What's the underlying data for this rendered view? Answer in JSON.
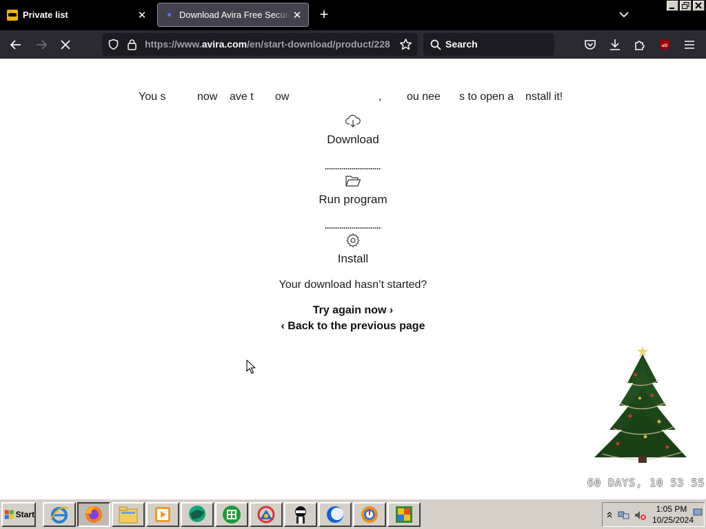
{
  "browser": {
    "tabs": [
      {
        "title": "Private list",
        "active": false
      },
      {
        "title": "Download Avira Free Security",
        "active": true
      }
    ],
    "url": {
      "prefix": "https://www.",
      "domain": "avira.com",
      "path": "/en/start-download/product/228"
    },
    "search_label": "Search",
    "accent_colors": {
      "tab_bg": "#42414d",
      "toolbar_bg": "#2b2a33",
      "field_bg": "#1c1b22"
    }
  },
  "page": {
    "instruction_fragments": [
      "You s",
      "now",
      "ave t",
      "ow",
      ",",
      "ou nee",
      "s to open a",
      "nstall it!"
    ],
    "steps": [
      {
        "label": "Download",
        "icon": "cloud-download-icon"
      },
      {
        "label": "Run program",
        "icon": "folder-open-icon"
      },
      {
        "label": "Install",
        "icon": "gear-icon"
      }
    ],
    "question": "Your download hasn’t started?",
    "try_again": "Try again now",
    "try_again_chevron": "›",
    "back_chevron": "‹",
    "back": "Back to the previous page",
    "countdown": "60 DAYS, 10 53 55"
  },
  "taskbar": {
    "start_label": "Start",
    "apps": [
      "internet-explorer",
      "firefox",
      "file-explorer",
      "media-player",
      "chat-app",
      "grid-app",
      "network-app",
      "ninja-app",
      "browser-c",
      "browser-o",
      "avg-app"
    ],
    "time": "1:05 PM",
    "date": "10/25/2024"
  }
}
